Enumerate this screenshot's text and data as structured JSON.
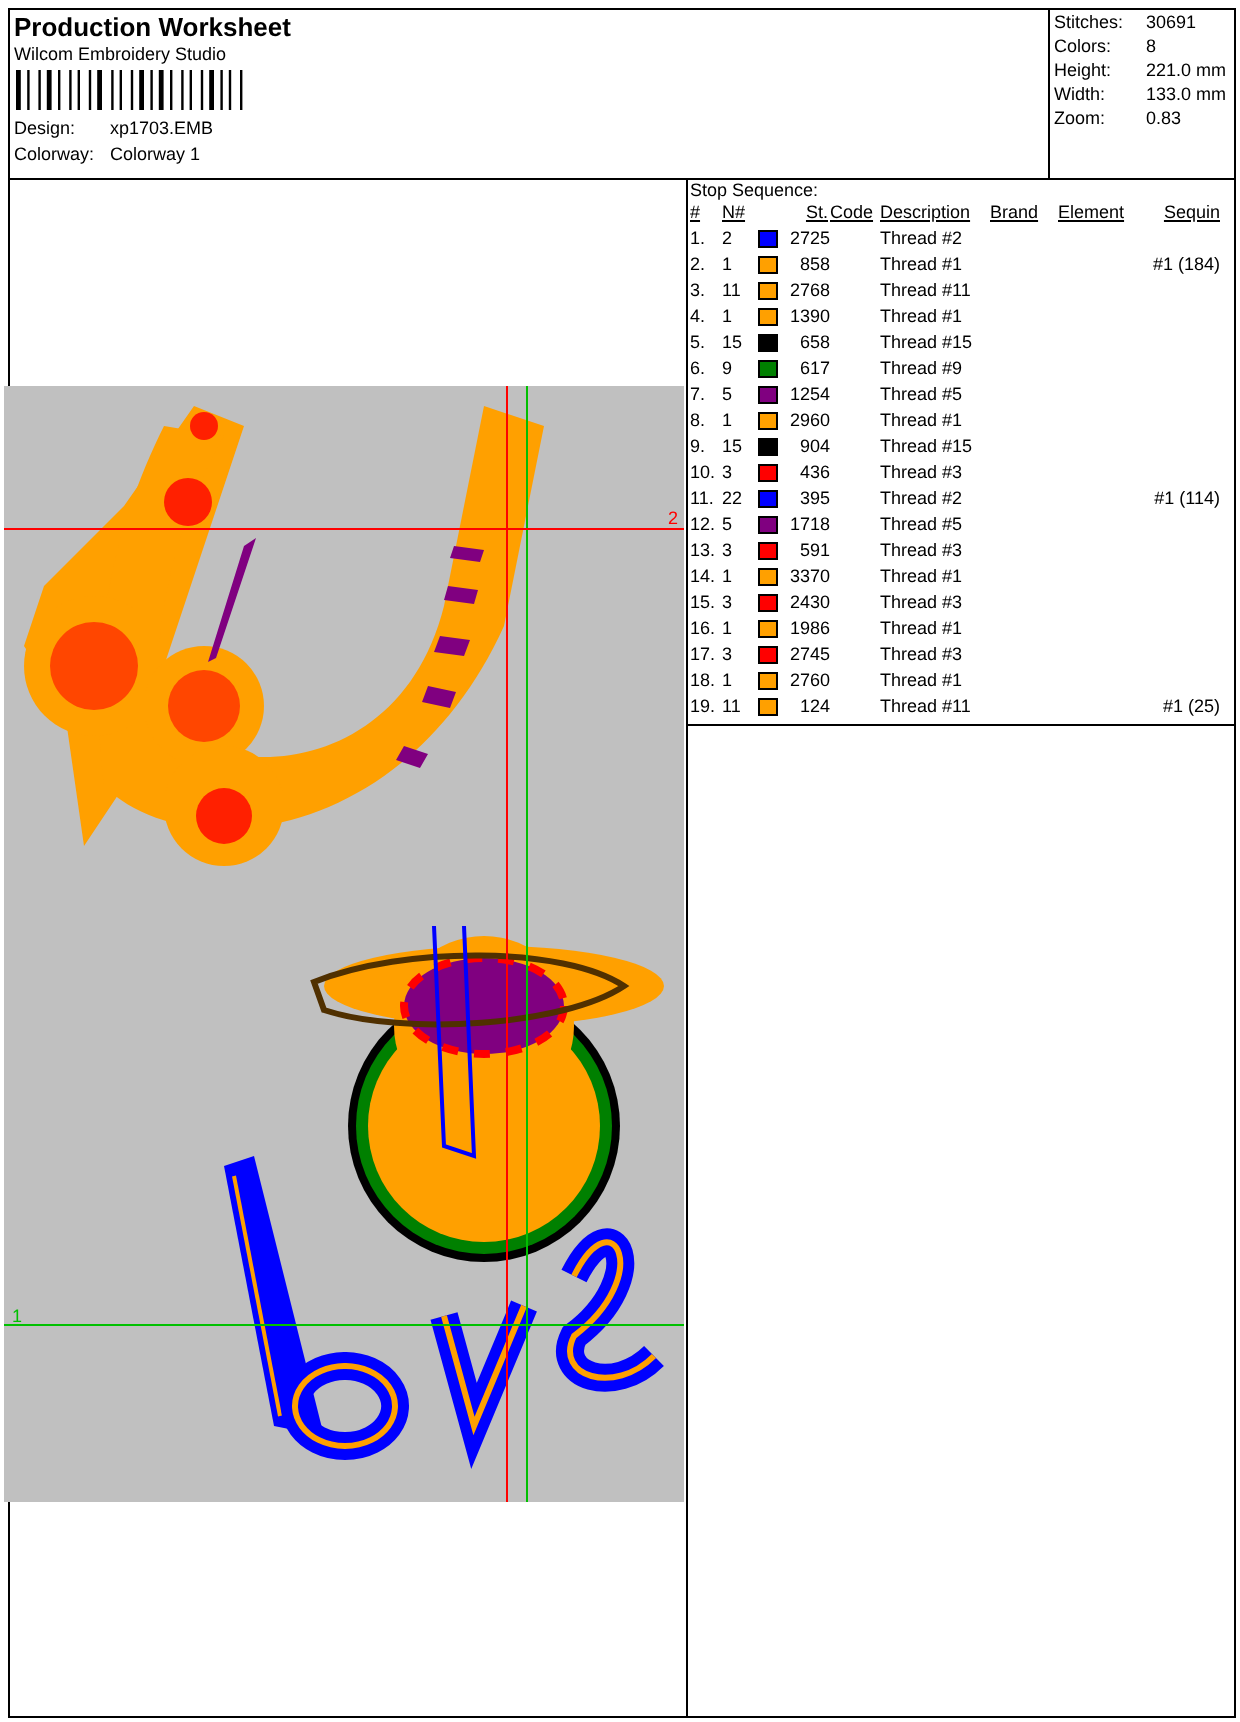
{
  "header": {
    "title": "Production Worksheet",
    "software": "Wilcom Embroidery Studio",
    "design": {
      "label": "Design:",
      "value": "xp1703.EMB"
    },
    "colorway": {
      "label": "Colorway:",
      "value": "Colorway 1"
    }
  },
  "stats": [
    {
      "label": "Stitches:",
      "value": "30691"
    },
    {
      "label": "Colors:",
      "value": "8"
    },
    {
      "label": "Height:",
      "value": "221.0 mm"
    },
    {
      "label": "Width:",
      "value": "133.0 mm"
    },
    {
      "label": "Zoom:",
      "value": "0.83"
    }
  ],
  "preview": {
    "guides": [
      {
        "label": "2",
        "color": "#ff0000"
      },
      {
        "label": "1",
        "color": "#00c000"
      }
    ]
  },
  "stop_sequence": {
    "title": "Stop Sequence:",
    "columns": [
      "#",
      "N#",
      "St.",
      "Code",
      "Description",
      "Brand",
      "Element",
      "Sequin"
    ],
    "rows": [
      {
        "index": "1.",
        "n": "2",
        "color": "#0000ff",
        "st": "2725",
        "description": "Thread #2",
        "sequin": ""
      },
      {
        "index": "2.",
        "n": "1",
        "color": "#ffa000",
        "st": "858",
        "description": "Thread #1",
        "sequin": "#1 (184)"
      },
      {
        "index": "3.",
        "n": "11",
        "color": "#ffa000",
        "st": "2768",
        "description": "Thread #11",
        "sequin": ""
      },
      {
        "index": "4.",
        "n": "1",
        "color": "#ffa000",
        "st": "1390",
        "description": "Thread #1",
        "sequin": ""
      },
      {
        "index": "5.",
        "n": "15",
        "color": "#000000",
        "st": "658",
        "description": "Thread #15",
        "sequin": ""
      },
      {
        "index": "6.",
        "n": "9",
        "color": "#008000",
        "st": "617",
        "description": "Thread #9",
        "sequin": ""
      },
      {
        "index": "7.",
        "n": "5",
        "color": "#800080",
        "st": "1254",
        "description": "Thread #5",
        "sequin": ""
      },
      {
        "index": "8.",
        "n": "1",
        "color": "#ffa000",
        "st": "2960",
        "description": "Thread #1",
        "sequin": ""
      },
      {
        "index": "9.",
        "n": "15",
        "color": "#000000",
        "st": "904",
        "description": "Thread #15",
        "sequin": ""
      },
      {
        "index": "10.",
        "n": "3",
        "color": "#ff0000",
        "st": "436",
        "description": "Thread #3",
        "sequin": ""
      },
      {
        "index": "11.",
        "n": "22",
        "color": "#0000ff",
        "st": "395",
        "description": "Thread #2",
        "sequin": "#1 (114)"
      },
      {
        "index": "12.",
        "n": "5",
        "color": "#800080",
        "st": "1718",
        "description": "Thread #5",
        "sequin": ""
      },
      {
        "index": "13.",
        "n": "3",
        "color": "#ff0000",
        "st": "591",
        "description": "Thread #3",
        "sequin": ""
      },
      {
        "index": "14.",
        "n": "1",
        "color": "#ffa000",
        "st": "3370",
        "description": "Thread #1",
        "sequin": ""
      },
      {
        "index": "15.",
        "n": "3",
        "color": "#ff0000",
        "st": "2430",
        "description": "Thread #3",
        "sequin": ""
      },
      {
        "index": "16.",
        "n": "1",
        "color": "#ffa000",
        "st": "1986",
        "description": "Thread #1",
        "sequin": ""
      },
      {
        "index": "17.",
        "n": "3",
        "color": "#ff0000",
        "st": "2745",
        "description": "Thread #3",
        "sequin": ""
      },
      {
        "index": "18.",
        "n": "1",
        "color": "#ffa000",
        "st": "2760",
        "description": "Thread #1",
        "sequin": ""
      },
      {
        "index": "19.",
        "n": "11",
        "color": "#ffa000",
        "st": "124",
        "description": "Thread #11",
        "sequin": "#1 (25)"
      }
    ]
  }
}
